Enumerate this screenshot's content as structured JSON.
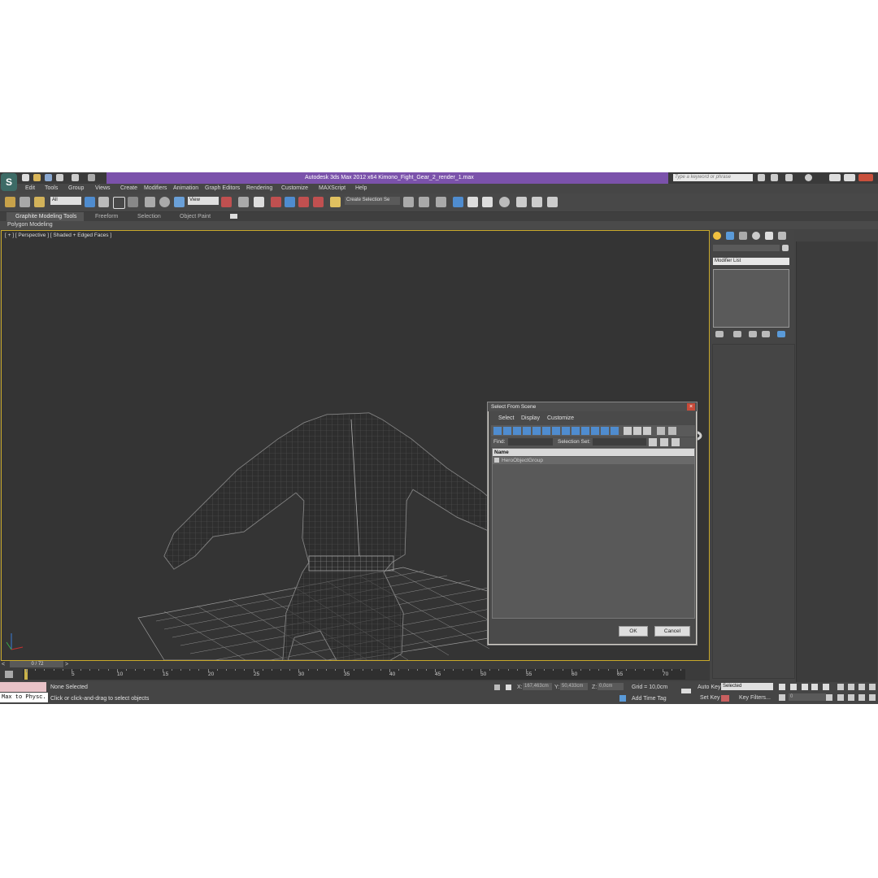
{
  "app": {
    "title": "Autodesk 3ds Max  2012 x64     Kimono_Fight_Gear_2_render_1.max",
    "search_placeholder": "Type a keyword or phrase"
  },
  "menu": [
    "Edit",
    "Tools",
    "Group",
    "Views",
    "Create",
    "Modifiers",
    "Animation",
    "Graph Editors",
    "Rendering",
    "Customize",
    "MAXScript",
    "Help"
  ],
  "toolbar": {
    "filter_value": "All",
    "refcoord_value": "View",
    "selection_set_value": "Create Selection Se"
  },
  "ribbon": {
    "tabs": [
      "Graphite Modeling Tools",
      "Freeform",
      "Selection",
      "Object Paint"
    ],
    "panel": "Polygon Modeling"
  },
  "viewport": {
    "label": "[ + ] [ Perspective ] [ Shaded + Edged Faces ]"
  },
  "command_panel": {
    "modifier_list": "Modifier List"
  },
  "dialog": {
    "title": "Select From Scene",
    "menu": [
      "Select",
      "Display",
      "Customize"
    ],
    "find_label": "Find:",
    "selection_set_label": "Selection Set:",
    "column_name": "Name",
    "rows": [
      "HeroObjectGroup"
    ],
    "ok": "OK",
    "cancel": "Cancel"
  },
  "timeline": {
    "frame": "0 / 72",
    "ticks": [
      "5",
      "10",
      "15",
      "20",
      "25",
      "30",
      "35",
      "40",
      "45",
      "50",
      "55",
      "60",
      "65",
      "70"
    ]
  },
  "status": {
    "script_listener": "Max to Physc.",
    "selection": "None Selected",
    "prompt": "Click or click-and-drag to select objects",
    "x_label": "X:",
    "x_value": "167,463cm",
    "y_label": "Y:",
    "y_value": "50,433cm",
    "z_label": "Z:",
    "z_value": "0,0cm",
    "grid": "Grid = 10,0cm",
    "add_time_tag": "Add Time Tag",
    "auto_key": "Auto Key",
    "selected": "Selected",
    "set_key": "Set Key",
    "key_filters": "Key Filters...",
    "frame_field": "0"
  },
  "colors": {
    "title_bar": "#7b52ab",
    "viewport_bg": "#343434",
    "viewport_border": "#c9a92b",
    "accent_blue": "#4f8ccf"
  }
}
